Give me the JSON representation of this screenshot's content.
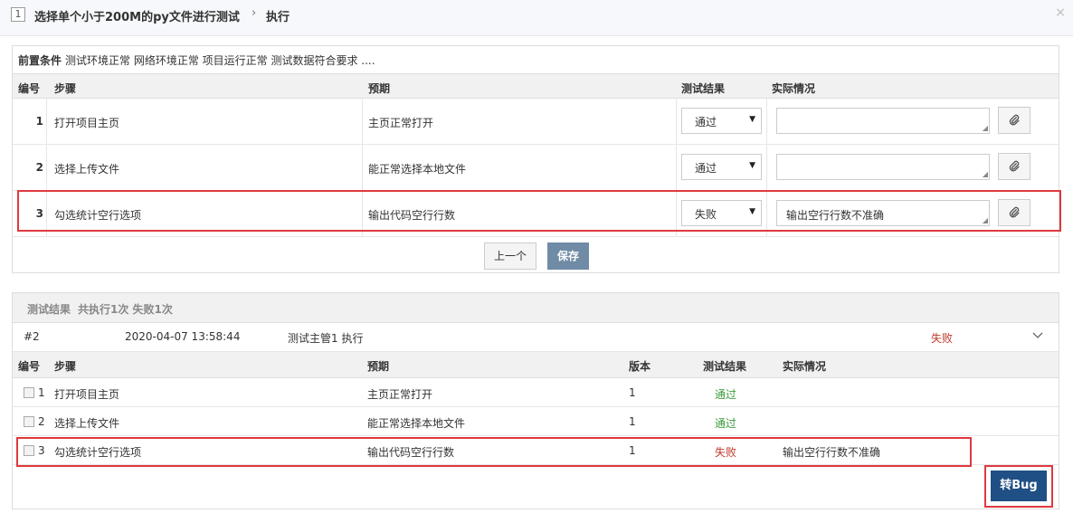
{
  "header": {
    "id": "1",
    "title": "选择单个小于200M的py文件进行测试",
    "separator": "›",
    "action": "执行",
    "close": "×"
  },
  "precondition": {
    "label": "前置条件",
    "text": "测试环境正常 网络环境正常 项目运行正常 测试数据符合要求 ...."
  },
  "steps_table": {
    "columns": [
      "编号",
      "步骤",
      "预期",
      "测试结果",
      "实际情况"
    ],
    "rows": [
      {
        "num": "1",
        "step": "打开项目主页",
        "expect": "主页正常打开",
        "result": "通过",
        "actual": ""
      },
      {
        "num": "2",
        "step": "选择上传文件",
        "expect": "能正常选择本地文件",
        "result": "通过",
        "actual": ""
      },
      {
        "num": "3",
        "step": "勾选统计空行选项",
        "expect": "输出代码空行行数",
        "result": "失败",
        "actual": "输出空行行数不准确"
      }
    ]
  },
  "buttons": {
    "prev": "上一个",
    "save": "保存",
    "to_bug": "转Bug"
  },
  "results": {
    "title": "测试结果",
    "summary": "共执行1次 失败1次",
    "run": {
      "id": "#2",
      "time": "2020-04-07 13:58:44",
      "executor": "测试主管1 执行",
      "status": "失败"
    },
    "columns": [
      "编号",
      "步骤",
      "预期",
      "版本",
      "测试结果",
      "实际情况"
    ],
    "rows": [
      {
        "num": "1",
        "step": "打开项目主页",
        "expect": "主页正常打开",
        "version": "1",
        "result": "通过",
        "actual": ""
      },
      {
        "num": "2",
        "step": "选择上传文件",
        "expect": "能正常选择本地文件",
        "version": "1",
        "result": "通过",
        "actual": ""
      },
      {
        "num": "3",
        "step": "勾选统计空行选项",
        "expect": "输出代码空行行数",
        "version": "1",
        "result": "失败",
        "actual": "输出空行行数不准确"
      }
    ]
  },
  "colors": {
    "fail": "#c0392b",
    "pass": "#3c9a3c",
    "highlight": "#e0393e",
    "primary": "#1f4f84"
  }
}
